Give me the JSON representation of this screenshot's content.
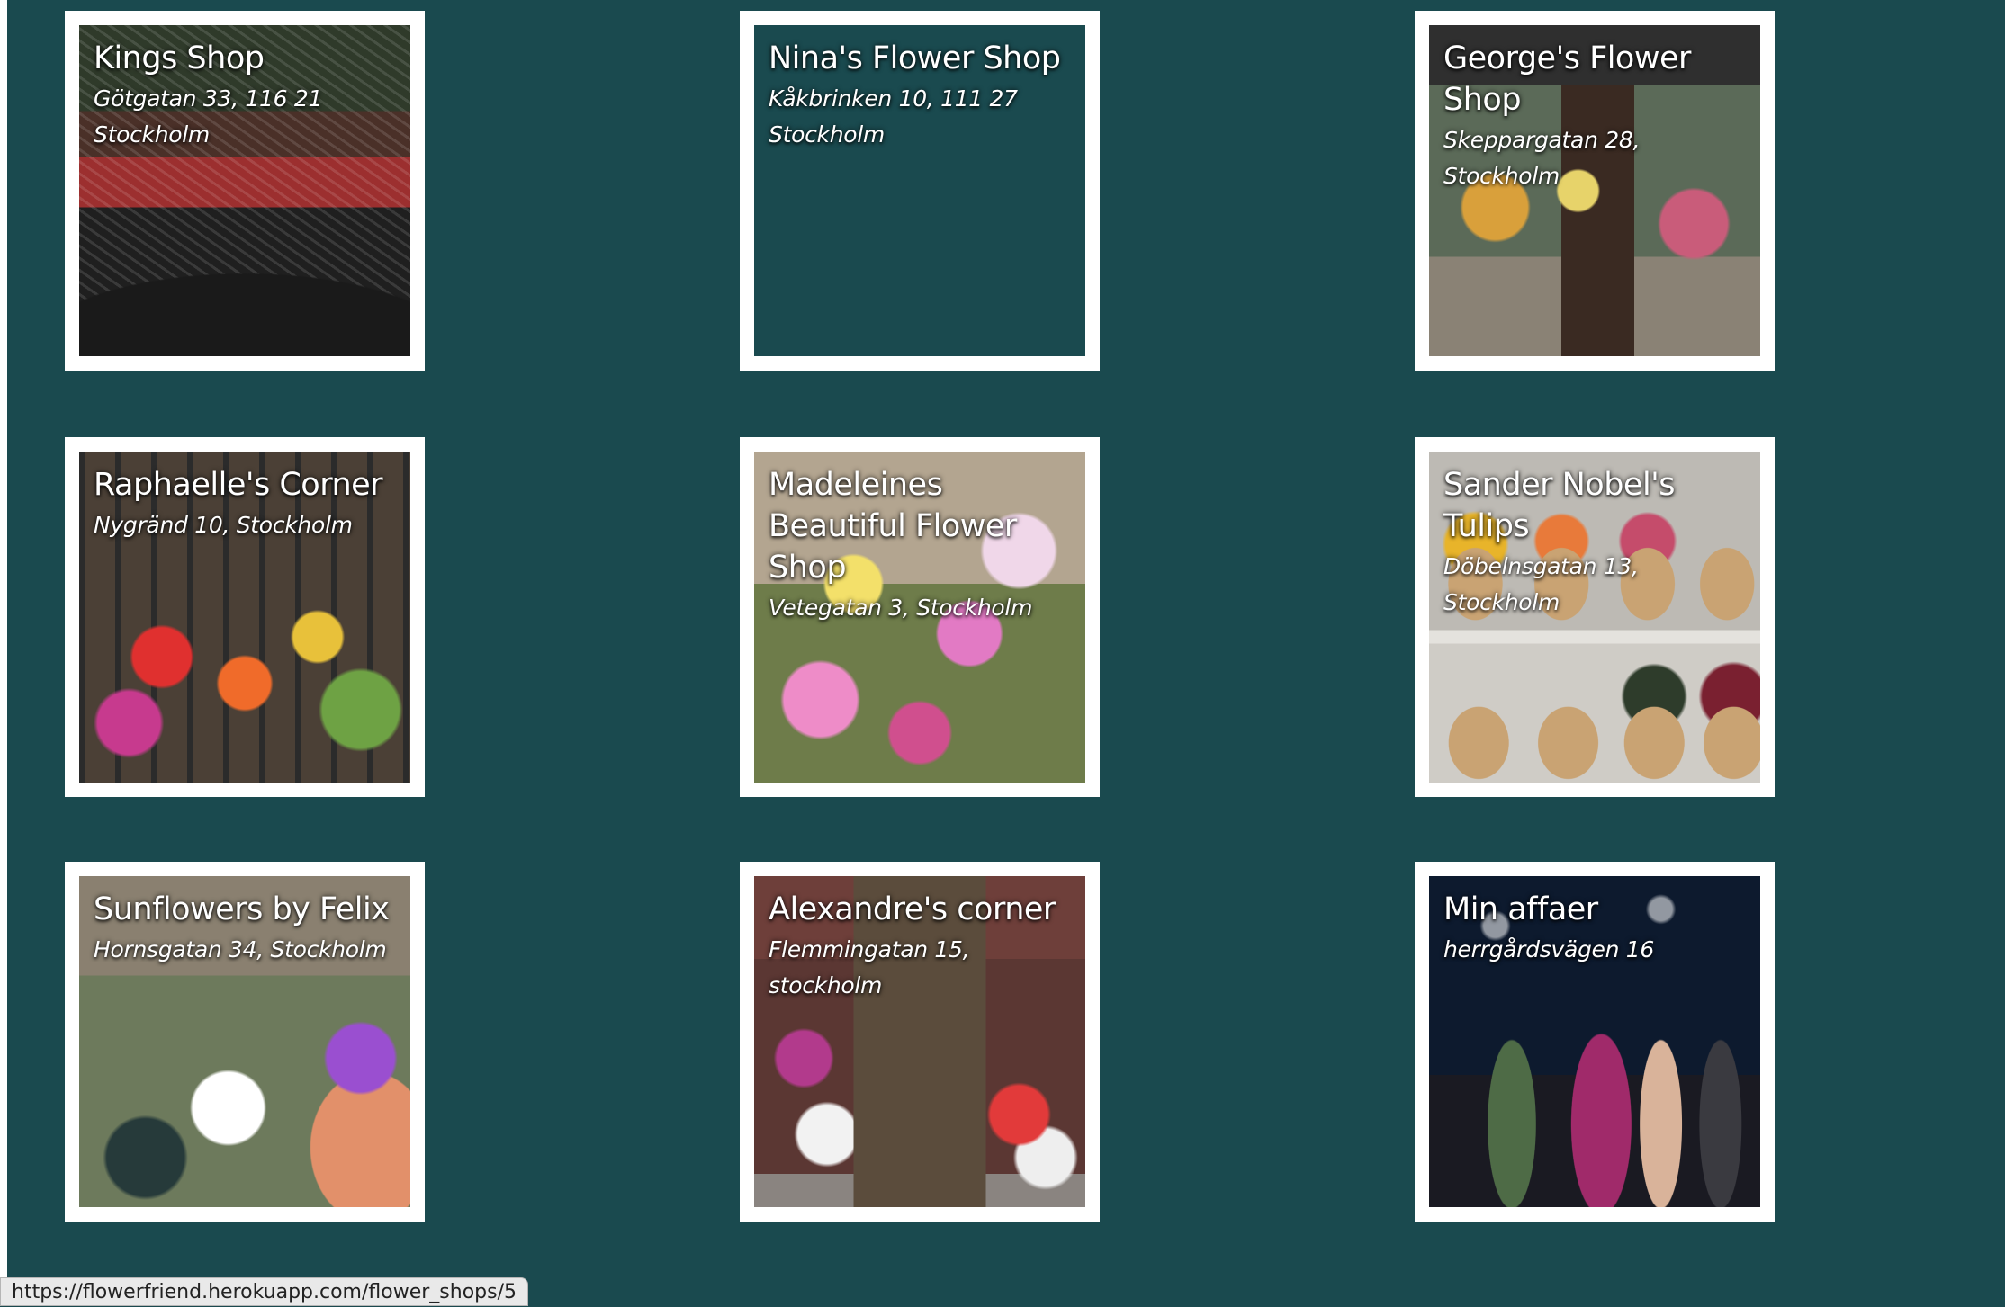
{
  "shops": [
    {
      "name": "Kings Shop",
      "address": "Götgatan 33, 116 21 Stockholm"
    },
    {
      "name": "Nina's Flower Shop",
      "address": "Kåkbrinken 10, 111 27 Stockholm"
    },
    {
      "name": "George's Flower Shop",
      "address": "Skeppargatan 28, Stockholm"
    },
    {
      "name": "Raphaelle's Corner",
      "address": "Nygränd 10, Stockholm"
    },
    {
      "name": "Madeleines Beautiful Flower Shop",
      "address": "Vetegatan 3, Stockholm"
    },
    {
      "name": "Sander Nobel's Tulips",
      "address": "Döbelnsgatan 13, Stockholm"
    },
    {
      "name": "Sunflowers by Felix",
      "address": "Hornsgatan 34, Stockholm"
    },
    {
      "name": "Alexandre's corner",
      "address": "Flemmingatan 15, stockholm"
    },
    {
      "name": "Min affaer",
      "address": "herrgårdsvägen 16"
    }
  ],
  "status_bar": {
    "url": "https://flowerfriend.herokuapp.com/flower_shops/5"
  },
  "colors": {
    "background": "#1a4a4f",
    "card_frame": "#ffffff",
    "text": "#ffffff"
  }
}
